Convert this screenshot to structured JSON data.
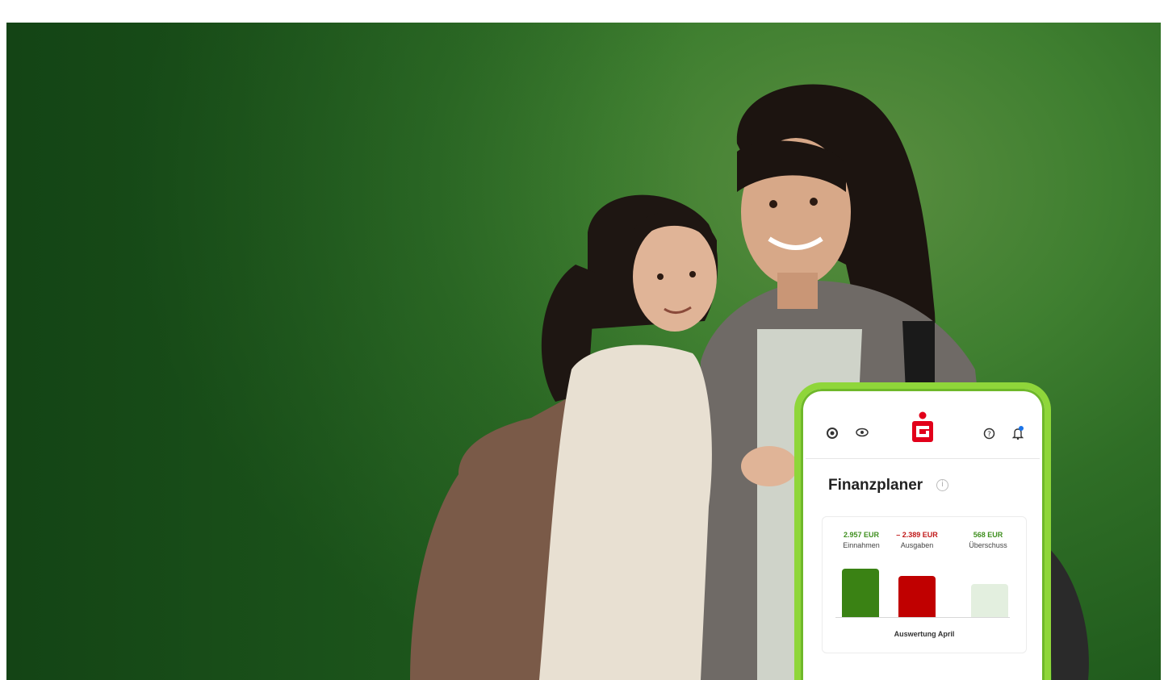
{
  "hero": {
    "alt": "Mother and daughter with school backpack"
  },
  "phone": {
    "header_icons": [
      "globe-icon",
      "eye-icon",
      "sparkasse-logo",
      "help-icon",
      "bell-icon"
    ],
    "title": "Finanzplaner",
    "info_icon": "i",
    "kpis": [
      {
        "value": "2.957 EUR",
        "label": "Einnahmen",
        "color": "#3f8f1f"
      },
      {
        "value": "– 2.389 EUR",
        "label": "Ausgaben",
        "color": "#c01818"
      },
      {
        "value": "568 EUR",
        "label": "Überschuss",
        "color": "#3f8f1f"
      }
    ],
    "bars": [
      {
        "label": "Einnahmen",
        "fraction": 1.0,
        "color": "#3a8214"
      },
      {
        "label": "Ausgaben",
        "fraction": 0.85,
        "color": "#c00000"
      },
      {
        "label": "Überschuss",
        "fraction": 0.68,
        "color": "#e3efdf"
      }
    ],
    "caption": "Auswertung April"
  },
  "colors": {
    "brand_red": "#e2001a",
    "phone_frame": "#8fd63a",
    "background_green": "#3f7f30"
  }
}
